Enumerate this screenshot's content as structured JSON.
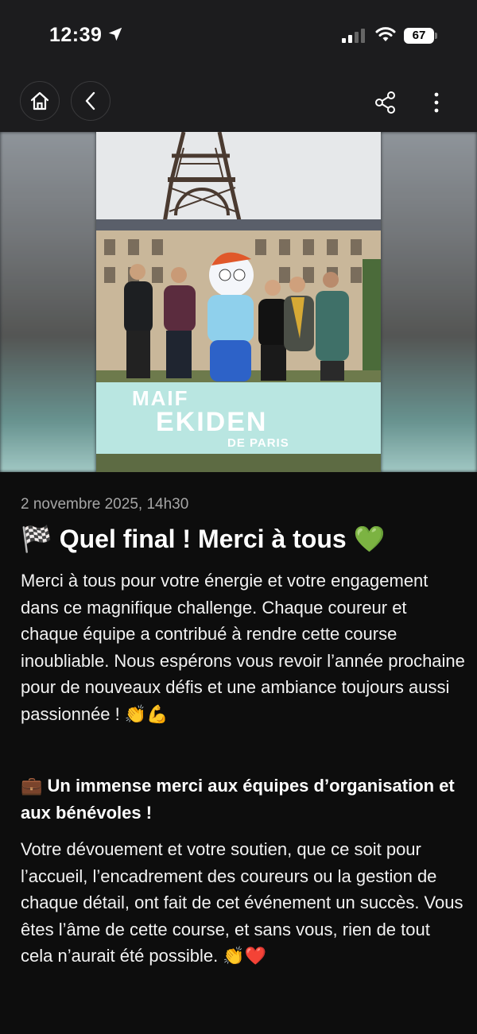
{
  "status_bar": {
    "time": "12:39",
    "battery": "67",
    "location_icon": "location-arrow-icon",
    "signal_icon": "cellular-signal-icon",
    "wifi_icon": "wifi-icon"
  },
  "nav": {
    "home_icon": "home-icon",
    "back_icon": "chevron-left-icon",
    "share_icon": "share-icon",
    "more_icon": "more-vertical-icon"
  },
  "hero": {
    "banner_line1": "MAIF",
    "banner_line2": "EKIDEN",
    "banner_line3": "DE PARIS"
  },
  "article": {
    "date": "2 novembre 2025, 14h30",
    "title": "🏁 Quel final ! Merci à tous 💚",
    "paragraph1": "Merci à tous pour votre énergie et votre engagement dans ce magnifique challenge. Chaque coureur et chaque équipe a contribué à rendre cette course inoubliable. Nous espérons vous revoir l’année prochaine pour de nouveaux défis et une ambiance toujours aussi passionnée ! 👏💪",
    "subtitle": "💼 Un immense merci aux équipes d’organisation et aux bénévoles !",
    "paragraph2": "Votre dévouement et votre soutien, que ce soit pour l’accueil, l’encadrement des coureurs ou la gestion de chaque détail, ont fait de cet événement un succès. Vous êtes l’âme de cette course, et sans vous, rien de tout cela n’aurait été possible. 👏❤️"
  },
  "colors": {
    "background": "#0d0d0d",
    "bar": "#1c1c1e",
    "banner": "#b9e6e1"
  }
}
